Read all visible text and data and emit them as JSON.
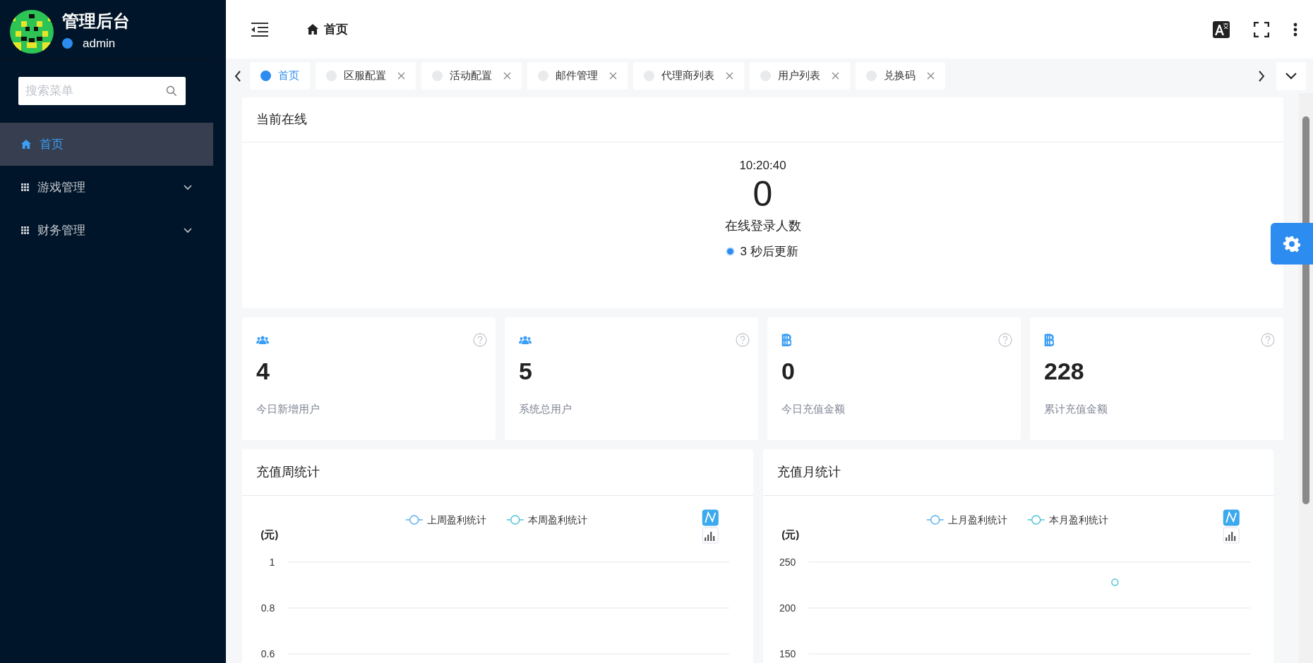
{
  "sidebar": {
    "title": "管理后台",
    "user": "admin"
  },
  "search": {
    "placeholder": "搜索菜单"
  },
  "menu": [
    {
      "label": "首页",
      "kind": "link",
      "selected": true
    },
    {
      "label": "游戏管理",
      "kind": "group",
      "selected": false,
      "expanded": false
    },
    {
      "label": "财务管理",
      "kind": "group",
      "selected": false,
      "expanded": false
    }
  ],
  "header": {
    "breadcrumb": "首页"
  },
  "tabs": [
    {
      "label": "首页",
      "selected": true,
      "closable": false
    },
    {
      "label": "区服配置",
      "selected": false,
      "closable": true
    },
    {
      "label": "活动配置",
      "selected": false,
      "closable": true
    },
    {
      "label": "邮件管理",
      "selected": false,
      "closable": true
    },
    {
      "label": "代理商列表",
      "selected": false,
      "closable": true
    },
    {
      "label": "用户列表",
      "selected": false,
      "closable": true
    },
    {
      "label": "兑换码",
      "selected": false,
      "closable": true
    }
  ],
  "online": {
    "title": "当前在线",
    "time": "10:20:40",
    "count": "0",
    "label": "在线登录人数",
    "refresh": "3 秒后更新"
  },
  "stats": [
    {
      "kind": "users",
      "value": "4",
      "label": "今日新增用户"
    },
    {
      "kind": "users",
      "value": "5",
      "label": "系统总用户"
    },
    {
      "kind": "currency",
      "value": "0",
      "label": "今日充值金额"
    },
    {
      "kind": "currency",
      "value": "228",
      "label": "累计充值金额"
    }
  ],
  "charts": [
    {
      "title": "充值周统计",
      "chart_data": {
        "type": "line",
        "ylabel": "(元)",
        "ylim": [
          0.6,
          1
        ],
        "yticks": [
          0.6,
          0.8,
          1
        ],
        "legend": "top",
        "series": [
          {
            "name": "上周盈利统计",
            "color": "#5ab1ef",
            "marker": true,
            "values": [
              null,
              null,
              null,
              null,
              null,
              null,
              null
            ]
          },
          {
            "name": "本周盈利统计",
            "color": "#4fc3d6",
            "marker": true,
            "values": [
              null,
              null,
              null,
              null,
              null,
              null,
              null
            ]
          }
        ]
      }
    },
    {
      "title": "充值月统计",
      "chart_data": {
        "type": "line",
        "ylabel": "(元)",
        "ylim": [
          150,
          250
        ],
        "yticks": [
          150,
          200,
          250
        ],
        "legend": "top",
        "series": [
          {
            "name": "上月盈利统计",
            "color": "#5ab1ef",
            "marker": true,
            "values": [
              null,
              null,
              null,
              null,
              null,
              null,
              null,
              null,
              null,
              null,
              null,
              null,
              null,
              null,
              null,
              null,
              null,
              null,
              null,
              null,
              null,
              null,
              null,
              null,
              null,
              null,
              null,
              null,
              null,
              null,
              null
            ]
          },
          {
            "name": "本月盈利统计",
            "color": "#4fc3d6",
            "marker": true,
            "values": [
              null,
              null,
              null,
              null,
              null,
              null,
              null,
              null,
              null,
              null,
              null,
              null,
              null,
              null,
              null,
              null,
              null,
              null,
              null,
              null,
              null,
              228,
              null,
              null,
              null,
              null,
              null,
              null,
              null,
              null,
              null
            ]
          }
        ]
      }
    }
  ]
}
